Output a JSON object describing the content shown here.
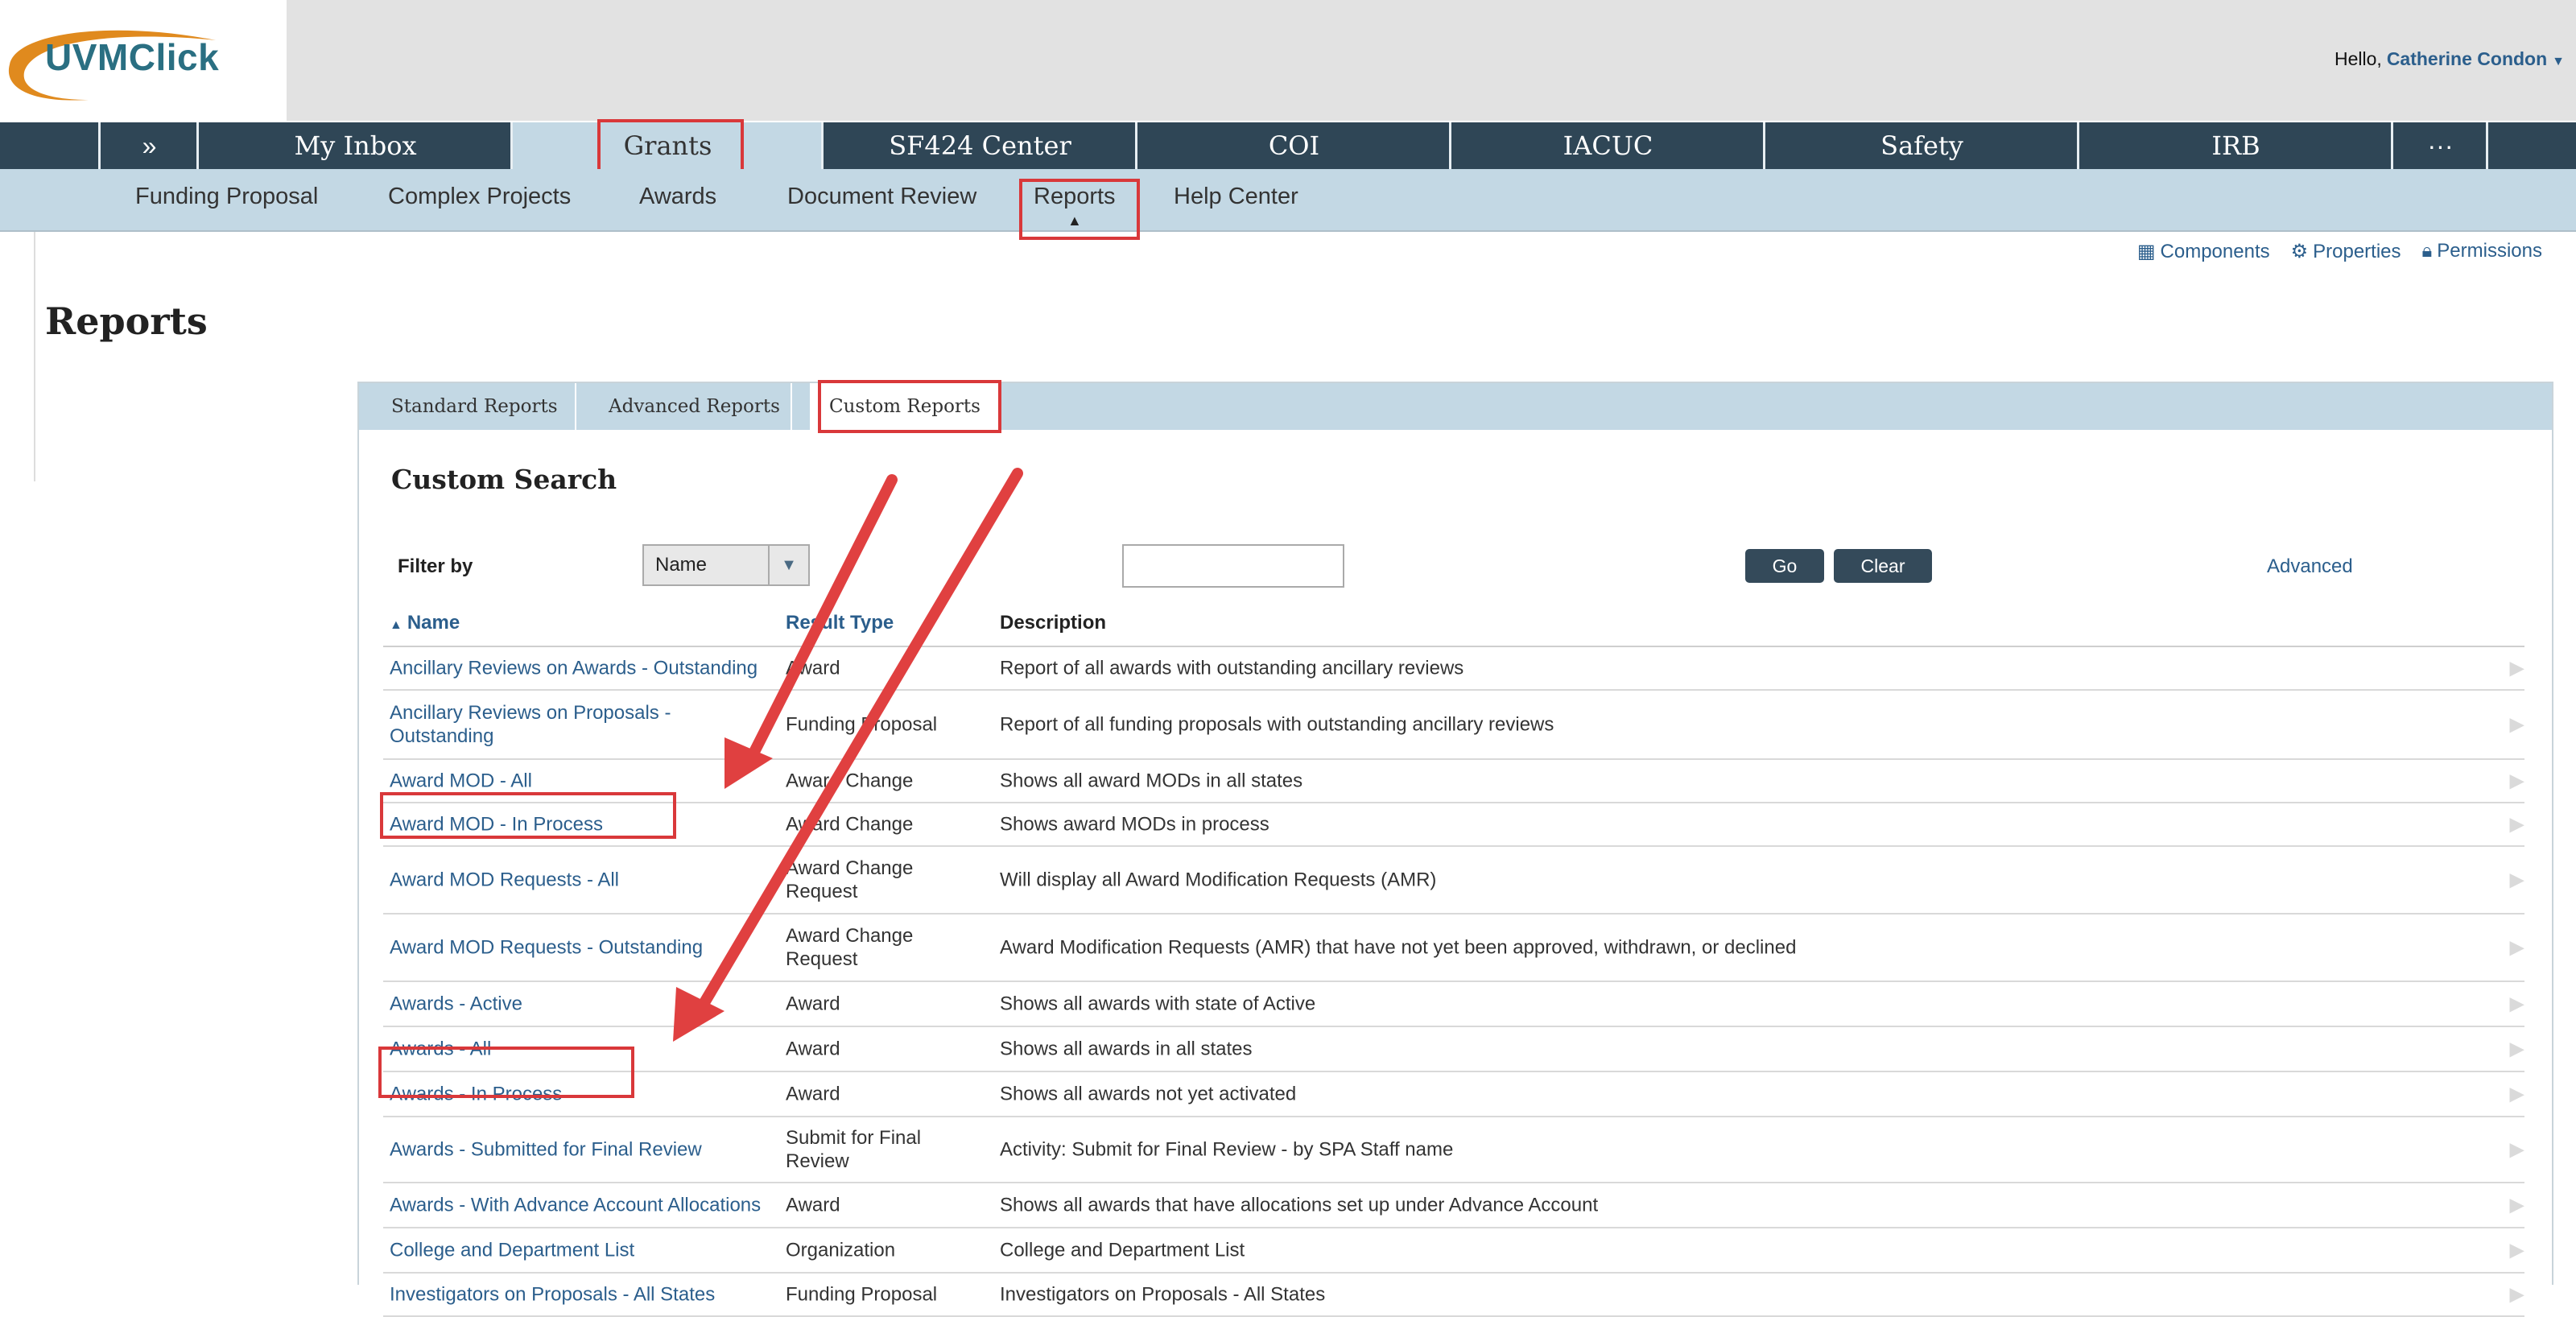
{
  "brand": {
    "logo_text": "UVMClick"
  },
  "user": {
    "greeting": "Hello,",
    "name": "Catherine Condon"
  },
  "main_nav": {
    "expand_label": "»",
    "tabs": [
      "My Inbox",
      "Grants",
      "SF424 Center",
      "COI",
      "IACUC",
      "Safety",
      "IRB"
    ],
    "more_label": "···"
  },
  "sub_nav": [
    "Funding Proposal",
    "Complex Projects",
    "Awards",
    "Document Review",
    "Reports",
    "Help Center"
  ],
  "tools": [
    "Components",
    "Properties",
    "Permissions"
  ],
  "page_title": "Reports",
  "report_tabs": [
    "Standard Reports",
    "Advanced Reports",
    "Custom Reports"
  ],
  "section_title": "Custom Search",
  "filter": {
    "label": "Filter by",
    "selected": "Name",
    "go": "Go",
    "clear": "Clear",
    "advanced": "Advanced",
    "value": ""
  },
  "columns": [
    "Name",
    "Result Type",
    "Description"
  ],
  "rows": [
    {
      "name": "Ancillary Reviews on Awards - Outstanding",
      "type": "Award",
      "desc": "Report of all awards with outstanding ancillary reviews"
    },
    {
      "name": "Ancillary Reviews on Proposals - Outstanding",
      "type": "Funding Proposal",
      "desc": "Report of all funding proposals with outstanding ancillary reviews"
    },
    {
      "name": "Award MOD - All",
      "type": "Award Change",
      "desc": "Shows all award MODs in all states"
    },
    {
      "name": "Award MOD - In Process",
      "type": "Award Change",
      "desc": "Shows award MODs in process"
    },
    {
      "name": "Award MOD Requests - All",
      "type": "Award Change Request",
      "desc": "Will display all Award Modification Requests (AMR)"
    },
    {
      "name": "Award MOD Requests - Outstanding",
      "type": "Award Change Request",
      "desc": "Award Modification Requests (AMR) that have not yet been approved, withdrawn, or declined"
    },
    {
      "name": "Awards - Active",
      "type": "Award",
      "desc": "Shows all awards with state of Active"
    },
    {
      "name": "Awards - All",
      "type": "Award",
      "desc": "Shows all awards in all states"
    },
    {
      "name": "Awards - In Process",
      "type": "Award",
      "desc": "Shows all awards not yet activated"
    },
    {
      "name": "Awards - Submitted for Final Review",
      "type": "Submit for Final Review",
      "desc": "Activity: Submit for Final Review - by SPA Staff name"
    },
    {
      "name": "Awards - With Advance Account Allocations",
      "type": "Award",
      "desc": "Shows all awards that have allocations set up under Advance Account"
    },
    {
      "name": "College and Department List",
      "type": "Organization",
      "desc": "College and Department List"
    },
    {
      "name": "Investigators on Proposals - All States",
      "type": "Funding Proposal",
      "desc": "Investigators on Proposals - All States"
    }
  ],
  "colors": {
    "nav_dark": "#2f4656",
    "nav_light": "#c3d8e4",
    "link": "#2b5e8c",
    "highlight": "#d9383a"
  }
}
